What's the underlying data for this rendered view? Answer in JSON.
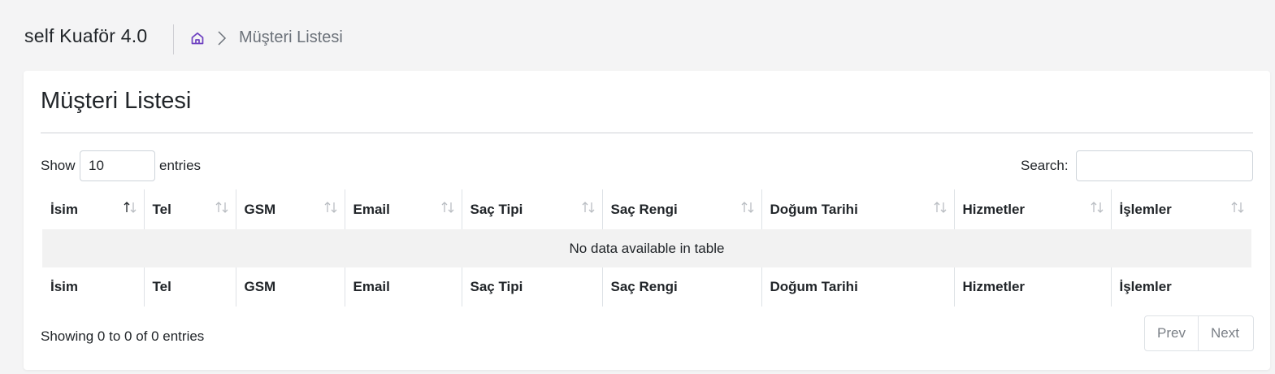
{
  "app": {
    "title": "self Kuaför 4.0",
    "accent_color": "#6f42c1"
  },
  "breadcrumb": {
    "home_icon": "home-icon",
    "separator_icon": "chevron-right-icon",
    "current": "Müşteri Listesi"
  },
  "card": {
    "title": "Müşteri Listesi"
  },
  "controls": {
    "show_label": "Show",
    "page_length": "10",
    "entries_label": "entries",
    "search_label": "Search:",
    "search_value": ""
  },
  "table": {
    "columns": [
      "İsim",
      "Tel",
      "GSM",
      "Email",
      "Saç Tipi",
      "Saç Rengi",
      "Doğum Tarihi",
      "Hizmetler",
      "İşlemler"
    ],
    "empty_message": "No data available in table",
    "sort_icon": "sort-arrows-icon"
  },
  "footer": {
    "info": "Showing 0 to 0 of 0 entries",
    "prev_label": "Prev",
    "next_label": "Next"
  }
}
